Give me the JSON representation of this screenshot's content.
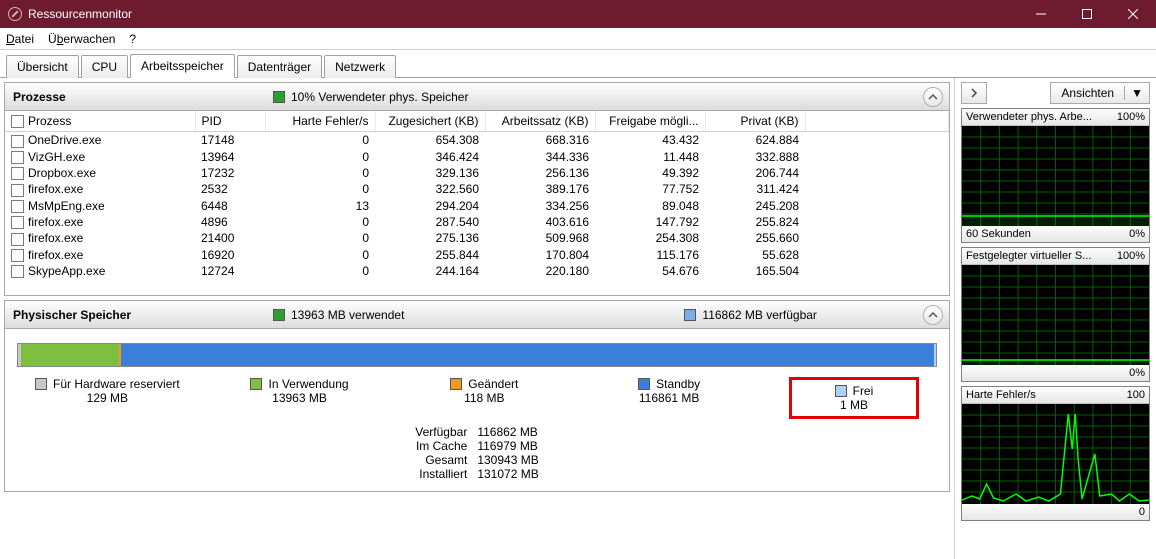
{
  "window": {
    "title": "Ressourcenmonitor"
  },
  "menu": {
    "file": "Datei",
    "monitor": "Überwachen",
    "help": "?"
  },
  "tabs": {
    "overview": "Übersicht",
    "cpu": "CPU",
    "memory": "Arbeitsspeicher",
    "disk": "Datenträger",
    "network": "Netzwerk"
  },
  "processes": {
    "title": "Prozesse",
    "summary": "10% Verwendeter phys. Speicher",
    "summary_color": "#2e9e2e",
    "columns": {
      "process": "Prozess",
      "pid": "PID",
      "hardfaults": "Harte Fehler/s",
      "commit": "Zugesichert (KB)",
      "workingset": "Arbeitssatz (KB)",
      "shareable": "Freigabe mögli...",
      "private": "Privat (KB)"
    },
    "rows": [
      {
        "name": "OneDrive.exe",
        "pid": "17148",
        "hf": "0",
        "commit": "654.308",
        "ws": "668.316",
        "share": "43.432",
        "priv": "624.884"
      },
      {
        "name": "VizGH.exe",
        "pid": "13964",
        "hf": "0",
        "commit": "346.424",
        "ws": "344.336",
        "share": "11.448",
        "priv": "332.888"
      },
      {
        "name": "Dropbox.exe",
        "pid": "17232",
        "hf": "0",
        "commit": "329.136",
        "ws": "256.136",
        "share": "49.392",
        "priv": "206.744"
      },
      {
        "name": "firefox.exe",
        "pid": "2532",
        "hf": "0",
        "commit": "322.560",
        "ws": "389.176",
        "share": "77.752",
        "priv": "311.424"
      },
      {
        "name": "MsMpEng.exe",
        "pid": "6448",
        "hf": "13",
        "commit": "294.204",
        "ws": "334.256",
        "share": "89.048",
        "priv": "245.208"
      },
      {
        "name": "firefox.exe",
        "pid": "4896",
        "hf": "0",
        "commit": "287.540",
        "ws": "403.616",
        "share": "147.792",
        "priv": "255.824"
      },
      {
        "name": "firefox.exe",
        "pid": "21400",
        "hf": "0",
        "commit": "275.136",
        "ws": "509.968",
        "share": "254.308",
        "priv": "255.660"
      },
      {
        "name": "firefox.exe",
        "pid": "16920",
        "hf": "0",
        "commit": "255.844",
        "ws": "170.804",
        "share": "115.176",
        "priv": "55.628"
      },
      {
        "name": "SkypeApp.exe",
        "pid": "12724",
        "hf": "0",
        "commit": "244.164",
        "ws": "220.180",
        "share": "54.676",
        "priv": "165.504"
      }
    ]
  },
  "physmem": {
    "title": "Physischer Speicher",
    "used_label": "13963 MB verwendet",
    "used_color": "#2e9e2e",
    "avail_label": "116862 MB verfügbar",
    "avail_color": "#7aaee8",
    "legend": {
      "reserved": {
        "label": "Für Hardware reserviert",
        "value": "129 MB",
        "color": "#c7c7c7"
      },
      "inuse": {
        "label": "In Verwendung",
        "value": "13963 MB",
        "color": "#7fbf3f"
      },
      "modified": {
        "label": "Geändert",
        "value": "118 MB",
        "color": "#f29a1f"
      },
      "standby": {
        "label": "Standby",
        "value": "116861 MB",
        "color": "#3a7fd9"
      },
      "free": {
        "label": "Frei",
        "value": "1 MB",
        "color": "#aed0f5"
      }
    },
    "summary": {
      "avail_k": "Verfügbar",
      "avail_v": "116862 MB",
      "cache_k": "Im Cache",
      "cache_v": "116979 MB",
      "total_k": "Gesamt",
      "total_v": "130943 MB",
      "inst_k": "Installiert",
      "inst_v": "131072 MB"
    }
  },
  "right": {
    "views": "Ansichten",
    "g1": {
      "title": "Verwendeter phys. Arbe...",
      "right": "100%",
      "foot_l": "60 Sekunden",
      "foot_r": "0%"
    },
    "g2": {
      "title": "Festgelegter virtueller S...",
      "right": "100%",
      "foot_r": "0%"
    },
    "g3": {
      "title": "Harte Fehler/s",
      "right": "100",
      "foot_r": "0"
    }
  }
}
